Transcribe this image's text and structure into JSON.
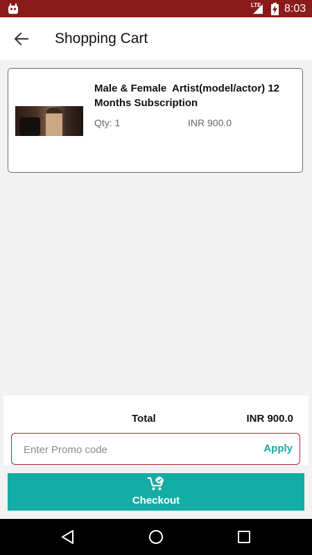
{
  "status_bar": {
    "network": "LTE",
    "time": "8:03",
    "icons": [
      "app-notification-icon",
      "signal-icon",
      "battery-charging-icon"
    ]
  },
  "app_bar": {
    "title": "Shopping Cart",
    "back_icon": "arrow-left-icon"
  },
  "cart": {
    "items": [
      {
        "name": "Male & Female  Artist(model/actor) 12 Months Subscription",
        "qty_label": "Qty: 1",
        "price": "INR 900.0"
      }
    ]
  },
  "summary": {
    "total_label": "Total",
    "total_value": "INR 900.0",
    "promo_placeholder": "Enter Promo code",
    "promo_value": "",
    "apply_label": "Apply"
  },
  "checkout": {
    "label": "Checkout",
    "icon": "cart-check-icon"
  },
  "nav_bar": {
    "icons": [
      "back-triangle-icon",
      "home-circle-icon",
      "recents-square-icon"
    ]
  },
  "colors": {
    "status_bar": "#8b1a1a",
    "accent_teal": "#14ada5",
    "promo_border": "#b22222",
    "background": "#f2f2f2"
  }
}
